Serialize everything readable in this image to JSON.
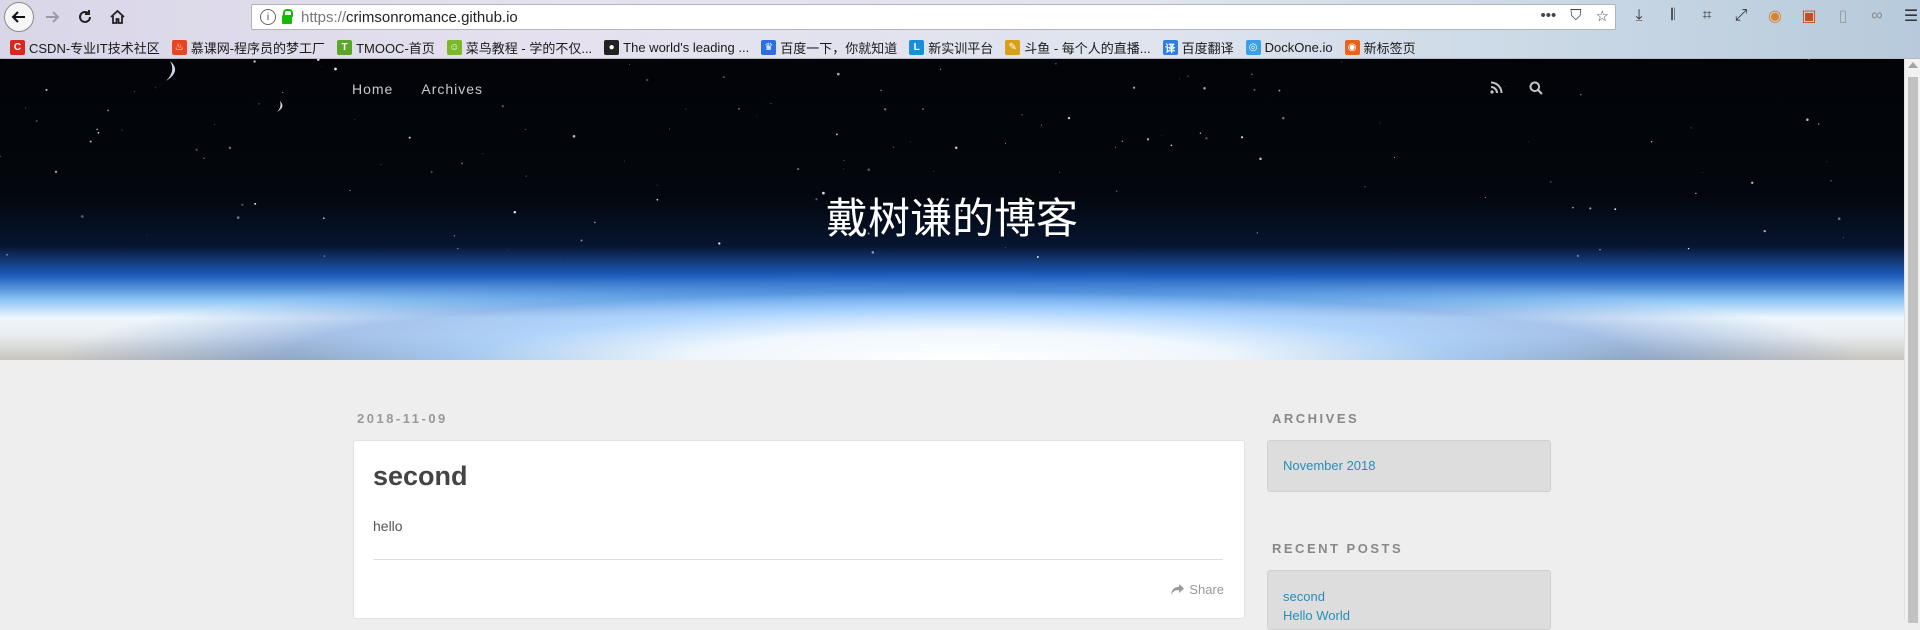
{
  "browser": {
    "url_protocol": "https://",
    "url_host": "crimsonromance.github.io",
    "bookmarks": [
      {
        "label": "CSDN-专业IT技术社区",
        "color": "#d8291e",
        "glyph": "C",
        "icon": "csdn-icon"
      },
      {
        "label": "慕课网-程序员的梦工厂",
        "color": "#e8451f",
        "glyph": "♨",
        "icon": "flame-icon"
      },
      {
        "label": "TMOOC-首页",
        "color": "#5aa628",
        "glyph": "T",
        "icon": "tmooc-icon"
      },
      {
        "label": "菜鸟教程 - 学的不仅...",
        "color": "#7bb82a",
        "glyph": "☺",
        "icon": "runoob-icon"
      },
      {
        "label": "The world's leading ...",
        "color": "#222222",
        "glyph": "●",
        "icon": "github-icon"
      },
      {
        "label": "百度一下，你就知道",
        "color": "#2d6fe0",
        "glyph": "♛",
        "icon": "baidu-icon"
      },
      {
        "label": "新实训平台",
        "color": "#1a8fd9",
        "glyph": "L",
        "icon": "lab-icon"
      },
      {
        "label": "斗鱼 - 每个人的直播...",
        "color": "#d9a015",
        "glyph": "✎",
        "icon": "douyu-icon"
      },
      {
        "label": "百度翻译",
        "color": "#2d7ee0",
        "glyph": "译",
        "icon": "translate-icon"
      },
      {
        "label": "DockOne.io",
        "color": "#3aa0e8",
        "glyph": "◎",
        "icon": "dockone-icon"
      },
      {
        "label": "新标签页",
        "color": "#e8641b",
        "glyph": "◉",
        "icon": "firefox-icon"
      }
    ]
  },
  "site": {
    "nav": [
      {
        "label": "Home"
      },
      {
        "label": "Archives"
      }
    ],
    "title": "戴树谦的博客"
  },
  "post": {
    "date": "2018-11-09",
    "title": "second",
    "body": "hello",
    "share_label": "Share"
  },
  "sidebar": {
    "archives_heading": "ARCHIVES",
    "archives": [
      {
        "label": "November 2018"
      }
    ],
    "recent_heading": "RECENT POSTS",
    "recent": [
      {
        "label": "second"
      },
      {
        "label": "Hello World"
      }
    ]
  }
}
